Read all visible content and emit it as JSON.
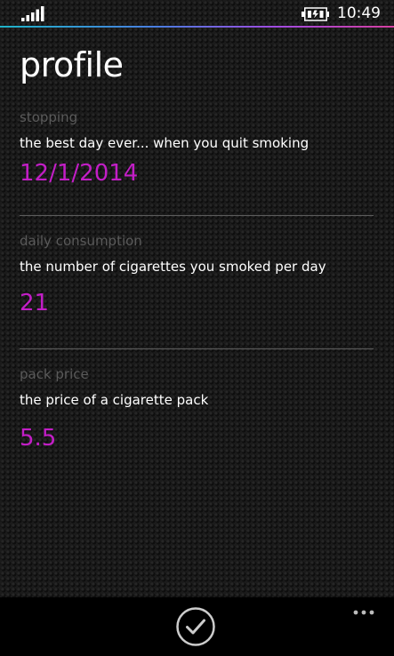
{
  "status_bar": {
    "signal_icon": "signal-strength-icon",
    "battery_icon": "battery-charging-icon",
    "time": "10:49"
  },
  "accent_colors": [
    "#1fb3c8",
    "#4a7de0",
    "#a04be0",
    "#d43fa0"
  ],
  "page": {
    "title": "profile"
  },
  "settings": [
    {
      "label": "stopping",
      "description": "the best day ever... when you quit smoking",
      "value": "12/1/2014"
    },
    {
      "label": "daily consumption",
      "description": "the number of cigarettes you smoked per day",
      "value": "21"
    },
    {
      "label": "pack price",
      "description": "the price of a cigarette pack",
      "value": "5.5"
    }
  ],
  "value_color": "#c21ec6",
  "app_bar": {
    "save_icon": "check-circle-icon",
    "more_icon": "more-ellipsis-icon"
  }
}
